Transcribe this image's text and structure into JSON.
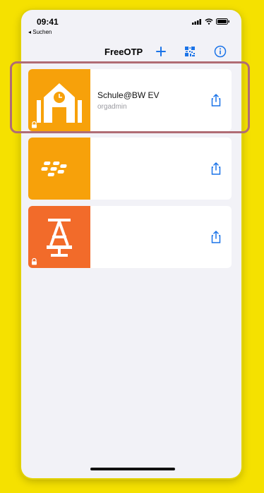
{
  "status_bar": {
    "time": "09:41",
    "back_label": "◂ Suchen"
  },
  "navbar": {
    "title": "FreeOTP",
    "add_icon": "plus-icon",
    "scan_icon": "qr-code-icon",
    "info_icon": "info-icon"
  },
  "tokens": [
    {
      "issuer": "Schule@BW EV",
      "label": "orgadmin",
      "color": "#f7a10a",
      "icon": "school-building-icon",
      "locked": true
    },
    {
      "issuer": "",
      "label": "",
      "color": "#f7a10a",
      "icon": "blackberry-icon",
      "locked": false
    },
    {
      "issuer": "",
      "label": "",
      "color": "#f26b2a",
      "icon": "anchor-a-icon",
      "locked": true
    }
  ],
  "colors": {
    "accent": "#1a73e8",
    "highlight": "#b06c74",
    "background": "#f5e100"
  }
}
